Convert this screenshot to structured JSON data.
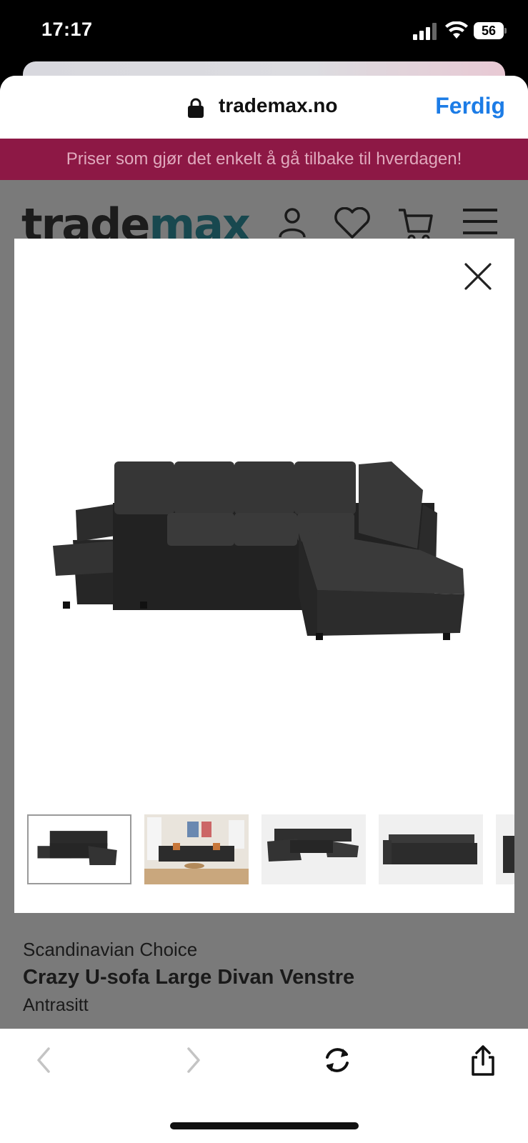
{
  "status_bar": {
    "time": "17:17",
    "battery": "56",
    "icons": [
      "signal-icon",
      "wifi-icon",
      "battery-icon"
    ]
  },
  "browser": {
    "url": "trademax.no",
    "done_label": "Ferdig"
  },
  "promo": {
    "text": "Priser som gjør det enkelt å gå tilbake til hverdagen!",
    "background": "#8d1845"
  },
  "header": {
    "logo_part1": "trade",
    "logo_part2": "max",
    "icons": [
      "user-icon",
      "heart-icon",
      "cart-icon",
      "menu-icon"
    ]
  },
  "gallery": {
    "close_icon": "close-icon",
    "main_image": "sofa-hero-image",
    "thumbnail_count": 5,
    "active_thumbnail": 1
  },
  "product": {
    "brand": "Scandinavian Choice",
    "name": "Crazy U-sofa Large Divan Venstre",
    "color": "Antrasitt"
  },
  "toolbar": {
    "icons": [
      "back-icon",
      "forward-icon",
      "reload-icon",
      "share-icon"
    ]
  },
  "colors": {
    "accent": "#1c7ce6",
    "logo_teal": "#18484f",
    "overlay": "#7a7a7a"
  }
}
